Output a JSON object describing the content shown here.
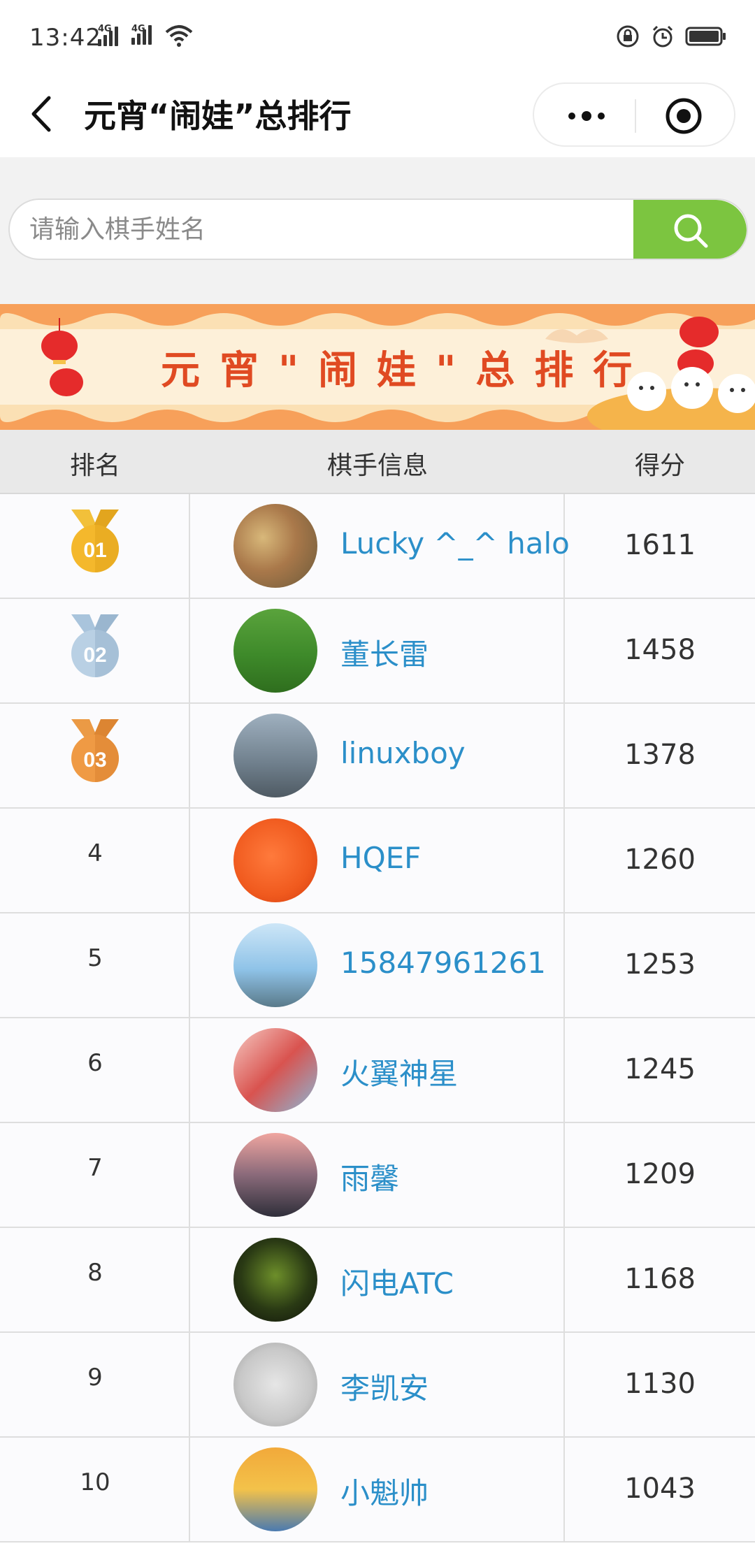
{
  "status_bar": {
    "time": "13:42",
    "network_1": "4G",
    "network_2": "4G"
  },
  "nav": {
    "title": "元宵“闹娃”总排行"
  },
  "search": {
    "placeholder": "请输入棋手姓名"
  },
  "banner": {
    "title": "元宵\"闹娃\"总排行"
  },
  "table": {
    "headers": {
      "rank": "排名",
      "player": "棋手信息",
      "score": "得分"
    },
    "rows": [
      {
        "rank": "01",
        "name": "Lucky ^_^ halo",
        "score": "1611"
      },
      {
        "rank": "02",
        "name": "董长雷",
        "score": "1458"
      },
      {
        "rank": "03",
        "name": "linuxboy",
        "score": "1378"
      },
      {
        "rank": "4",
        "name": "HQEF",
        "score": "1260"
      },
      {
        "rank": "5",
        "name": "15847961261",
        "score": "1253"
      },
      {
        "rank": "6",
        "name": "火翼神星",
        "score": "1245"
      },
      {
        "rank": "7",
        "name": "雨馨",
        "score": "1209"
      },
      {
        "rank": "8",
        "name": "闪电ATC",
        "score": "1168"
      },
      {
        "rank": "9",
        "name": "李凯安",
        "score": "1130"
      },
      {
        "rank": "10",
        "name": "小魁帅",
        "score": "1043"
      }
    ]
  },
  "colors": {
    "accent_green": "#7cc540",
    "name_blue": "#2b8fc9",
    "banner_red": "#e04a22",
    "gold": "#f2b630",
    "silver": "#a9c4dc",
    "bronze": "#e98f3d"
  }
}
